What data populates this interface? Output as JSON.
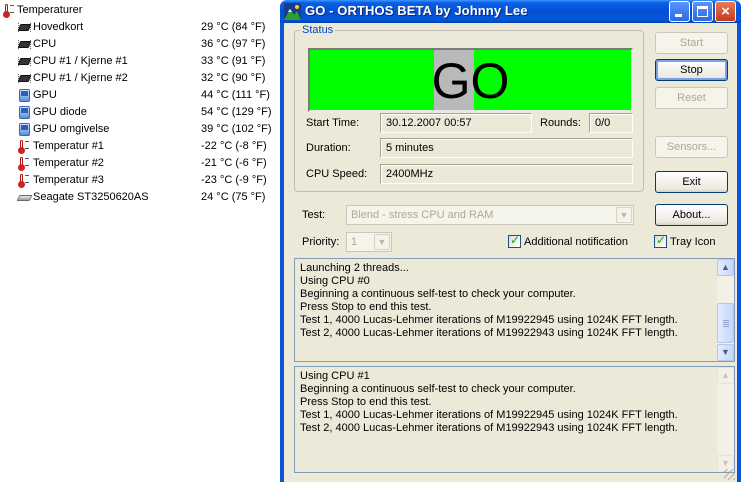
{
  "tree": {
    "root": {
      "label": "Temperaturer",
      "icon": "thermometer-icon"
    },
    "items": [
      {
        "label": "Hovedkort",
        "value": "29 °C  (84 °F)",
        "icon": "motherboard-icon"
      },
      {
        "label": "CPU",
        "value": "36 °C  (97 °F)",
        "icon": "cpu-chip-icon"
      },
      {
        "label": "CPU #1 / Kjerne #1",
        "value": "33 °C  (91 °F)",
        "icon": "cpu-chip-icon"
      },
      {
        "label": "CPU #1 / Kjerne #2",
        "value": "32 °C  (90 °F)",
        "icon": "cpu-chip-icon"
      },
      {
        "label": "GPU",
        "value": "44 °C  (111 °F)",
        "icon": "gpu-icon"
      },
      {
        "label": "GPU diode",
        "value": "54 °C  (129 °F)",
        "icon": "gpu-icon"
      },
      {
        "label": "GPU omgivelse",
        "value": "39 °C  (102 °F)",
        "icon": "gpu-icon"
      },
      {
        "label": "Temperatur #1",
        "value": "-22 °C  (-8 °F)",
        "icon": "thermometer-icon"
      },
      {
        "label": "Temperatur #2",
        "value": "-21 °C  (-6 °F)",
        "icon": "thermometer-icon"
      },
      {
        "label": "Temperatur #3",
        "value": "-23 °C  (-9 °F)",
        "icon": "thermometer-icon"
      },
      {
        "label": "Seagate ST3250620AS",
        "value": "24 °C  (75 °F)",
        "icon": "hard-drive-icon"
      }
    ]
  },
  "window": {
    "title": "GO - ORTHOS BETA by Johnny Lee",
    "titlebar_color": "#0350d0",
    "controls": {
      "minimize": "minimize-icon",
      "maximize": "maximize-icon",
      "close": "×"
    }
  },
  "status": {
    "legend": "Status",
    "banner_text": "GO",
    "banner_color": "#00ff00",
    "start_time_label": "Start Time:",
    "start_time_value": "30.12.2007 00:57",
    "rounds_label": "Rounds:",
    "rounds_value": "0/0",
    "duration_label": "Duration:",
    "duration_value": "5 minutes",
    "cpu_speed_label": "CPU Speed:",
    "cpu_speed_value": "2400MHz"
  },
  "buttons": {
    "start": "Start",
    "stop": "Stop",
    "reset": "Reset",
    "sensors": "Sensors...",
    "exit": "Exit",
    "about": "About..."
  },
  "test": {
    "label": "Test:",
    "selected": "Blend - stress CPU and RAM",
    "arrow": "▼"
  },
  "priority": {
    "label": "Priority:",
    "selected": "1",
    "arrow": "▼"
  },
  "options": {
    "additional_notification": {
      "label": "Additional notification",
      "checked": true,
      "mark": "✓"
    },
    "tray_icon": {
      "label": "Tray Icon",
      "checked": true,
      "mark": "✓"
    }
  },
  "log_cpu0": {
    "lines": [
      "Launching 2 threads...",
      "Using CPU #0",
      "Beginning a continuous self-test to check your computer.",
      "Press Stop to end this test.",
      "Test 1, 4000 Lucas-Lehmer iterations of M19922945 using 1024K FFT length.",
      "Test 2, 4000 Lucas-Lehmer iterations of M19922943 using 1024K FFT length."
    ],
    "scroll_up": "▲",
    "scroll_down": "▼"
  },
  "log_cpu1": {
    "lines": [
      "Using CPU #1",
      "Beginning a continuous self-test to check your computer.",
      "Press Stop to end this test.",
      "Test 1, 4000 Lucas-Lehmer iterations of M19922945 using 1024K FFT length.",
      "Test 2, 4000 Lucas-Lehmer iterations of M19922943 using 1024K FFT length."
    ],
    "scroll_up": "▲",
    "scroll_down": "▼"
  }
}
